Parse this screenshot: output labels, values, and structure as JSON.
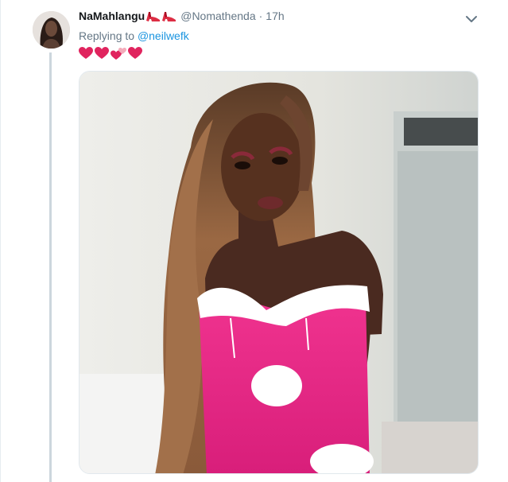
{
  "tweet": {
    "display_name": "NaMahlangu",
    "name_emoji": [
      "high-heel-icon",
      "high-heel-icon"
    ],
    "handle": "@Nomathenda",
    "separator": "·",
    "timestamp": "17h",
    "replying_label": "Replying to",
    "replying_to": "@neilwefk",
    "body_emoji": [
      "red-heart-icon",
      "red-heart-icon",
      "two-hearts-icon",
      "red-heart-icon"
    ],
    "media": {
      "kind": "photo",
      "subject": "person-in-pink-outfit"
    }
  },
  "colors": {
    "secondary_text": "#657786",
    "link": "#1b95e0",
    "thread_line": "#ccd6dd",
    "heart": "#e0245e"
  }
}
